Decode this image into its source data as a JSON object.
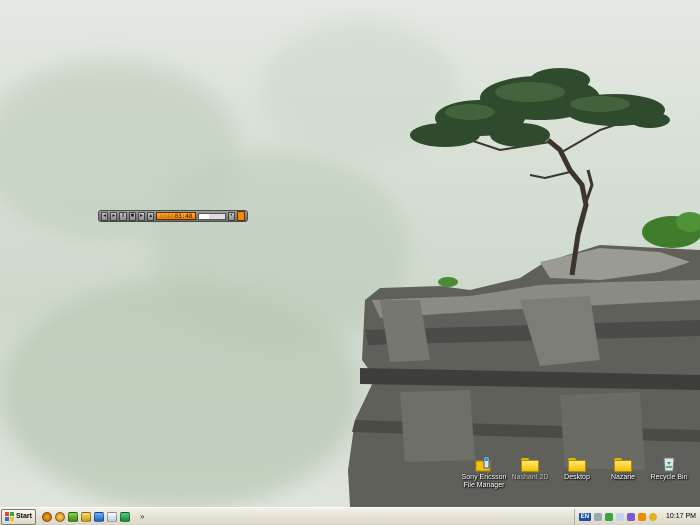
{
  "desktop": {
    "icons": [
      {
        "label": "Sony Ericsson\nFile Manager",
        "icon": "phone-folder-icon"
      },
      {
        "label": "Nashant 2D",
        "icon": "folder-icon"
      },
      {
        "label": "Desktop",
        "icon": "folder-icon"
      },
      {
        "label": "Nazarie",
        "icon": "folder-icon"
      },
      {
        "label": "Recycle Bin",
        "icon": "recycle-bin-icon"
      }
    ]
  },
  "media_player": {
    "time": "03:48",
    "track": "0348",
    "seek_fraction": 0.4
  },
  "taskbar": {
    "start_label": "Start",
    "quick_launch": [
      "firefox-icon",
      "media-icon",
      "bolt-icon",
      "pen-icon",
      "paint-icon",
      "window-icon",
      "maxthon-icon"
    ],
    "overflow_label": "»",
    "language": "EN",
    "clock": "10:17 PM"
  },
  "colors": {
    "taskbar_bg": "#ece9d8",
    "player_display": "#f59a1a"
  }
}
